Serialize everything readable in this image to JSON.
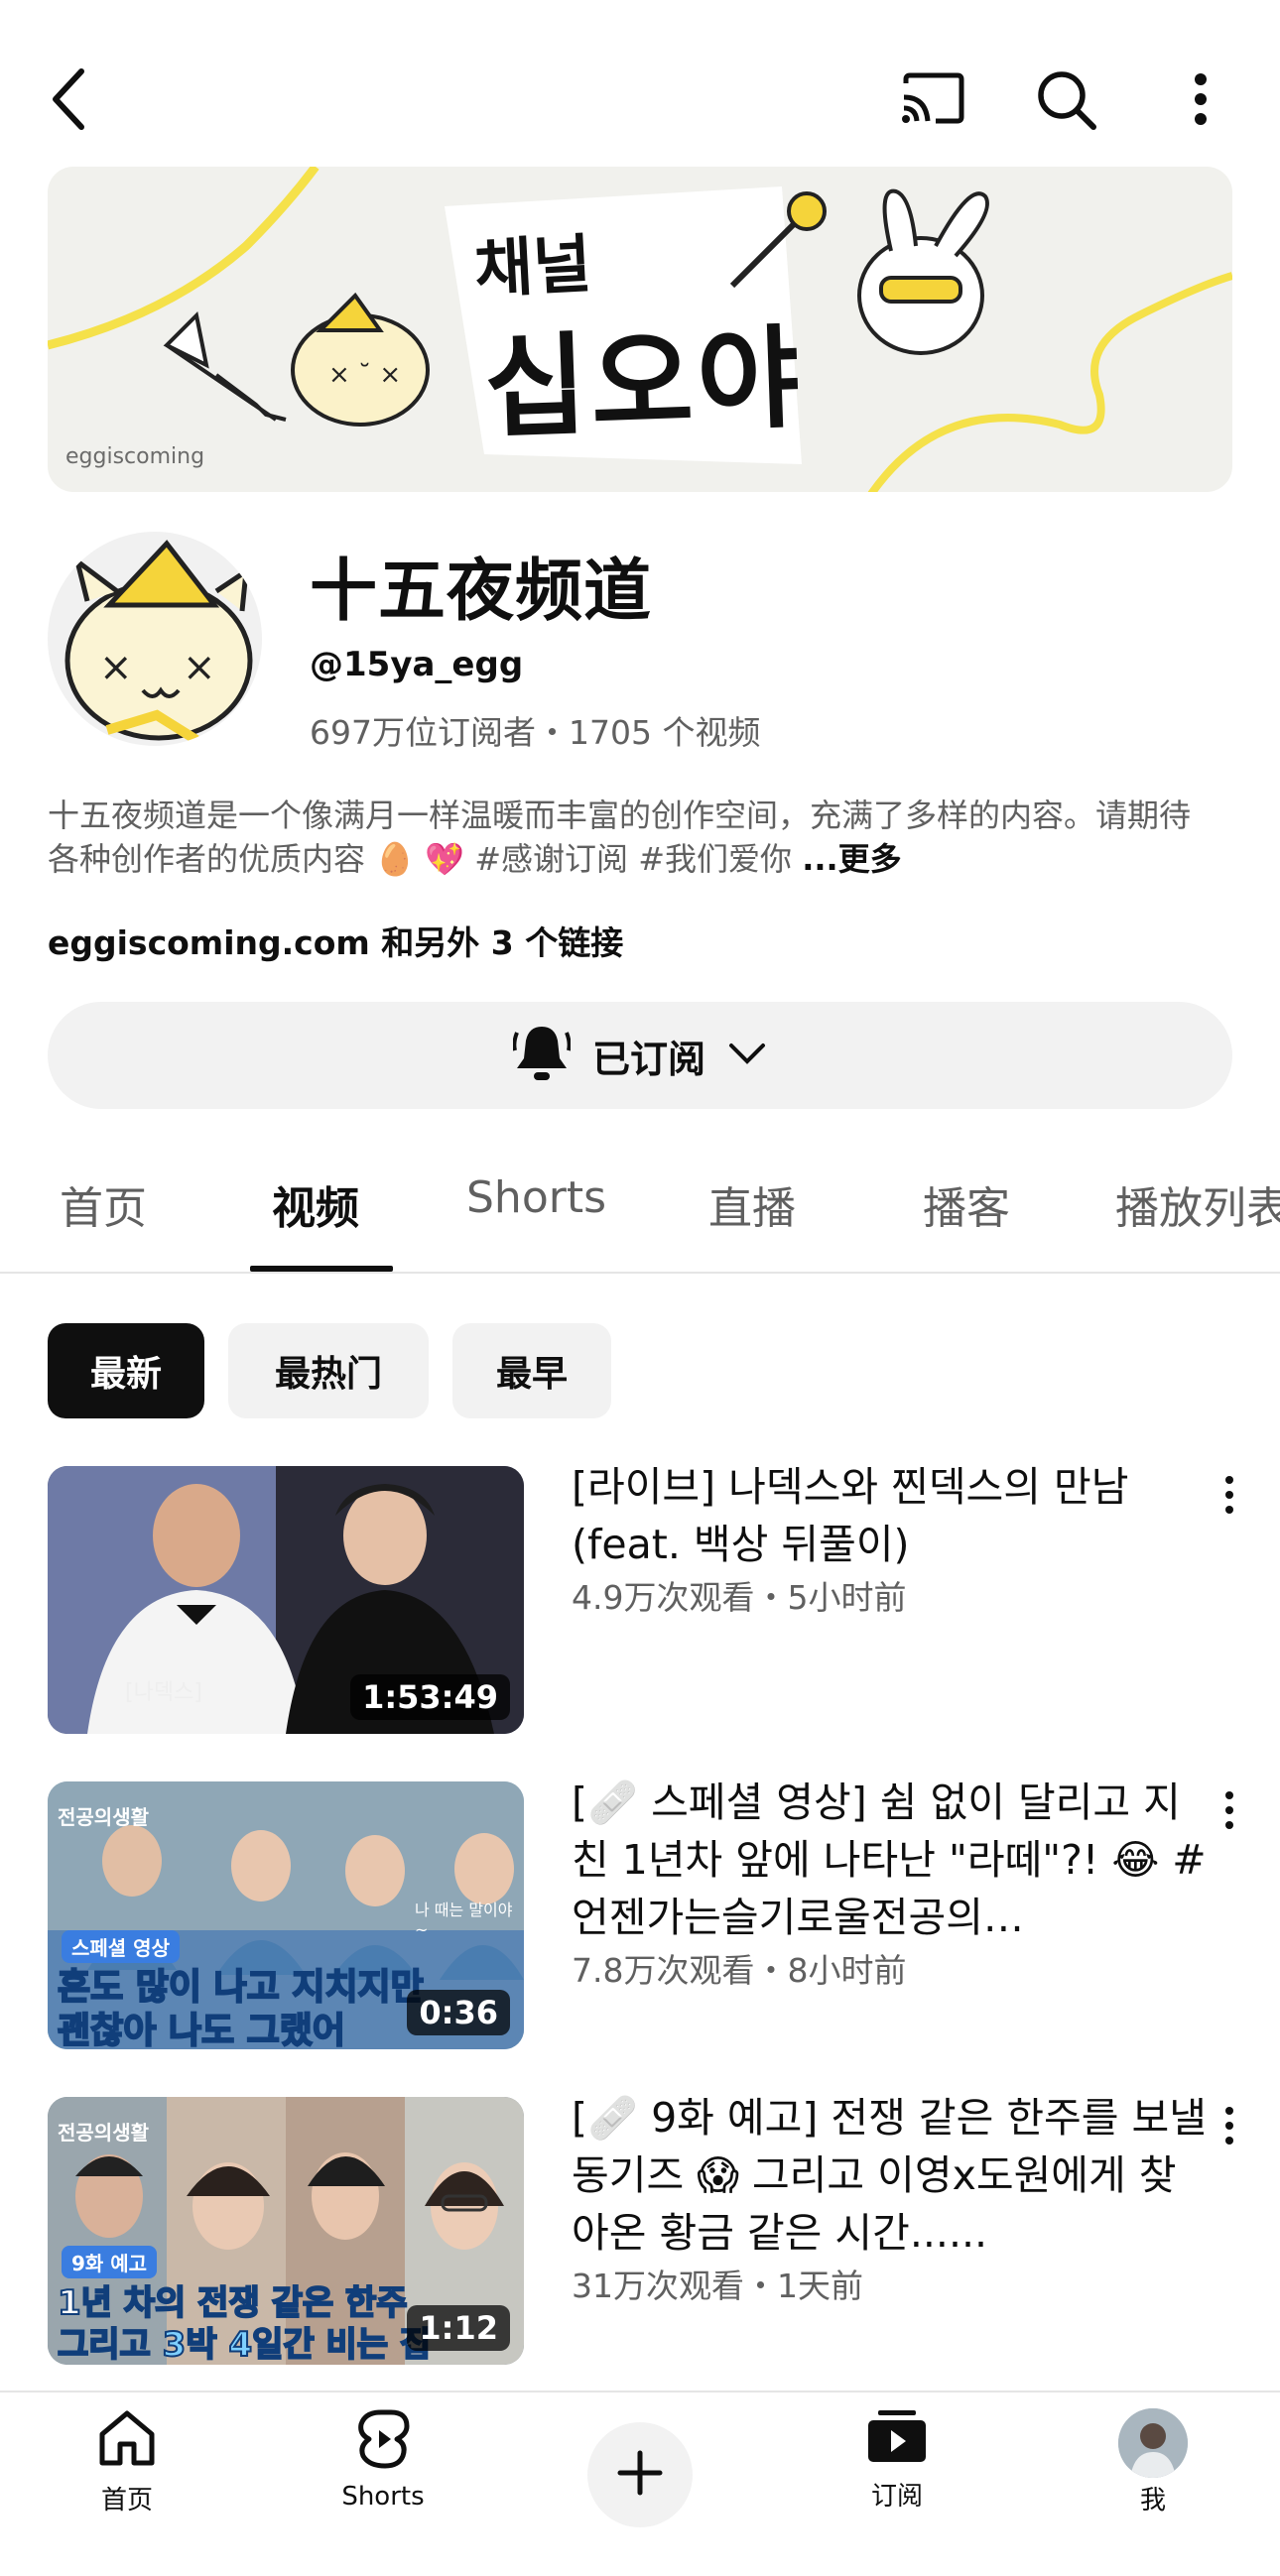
{
  "banner": {
    "korean_title_line1": "채널",
    "korean_title_line2": "십오야",
    "watermark": "eggiscoming"
  },
  "channel": {
    "name": "十五夜频道",
    "handle": "@15ya_egg",
    "stats": "697万位订阅者・1705 个视频",
    "description": "十五夜频道是一个像满月一样温暖而丰富的创作空间，充满了多样的内容。请期待各种创作者的优质内容 🥚 💖 #感谢订阅 #我们爱你",
    "more_label": "...更多",
    "links": "eggiscoming.com 和另外 3 个链接"
  },
  "subscribe": {
    "label": "已订阅"
  },
  "tabs": [
    {
      "label": "首页"
    },
    {
      "label": "视频"
    },
    {
      "label": "Shorts"
    },
    {
      "label": "直播"
    },
    {
      "label": "播客"
    },
    {
      "label": "播放列表"
    }
  ],
  "active_tab": "视频",
  "chips": [
    {
      "label": "最新"
    },
    {
      "label": "最热门"
    },
    {
      "label": "最早"
    }
  ],
  "videos": [
    {
      "title": "[라이브] 나덱스와 찐덱스의 만남 (feat. 백상 뒤풀이)",
      "meta": "4.9万次观看・5小时前",
      "duration": "1:53:49",
      "thumb_caption": "[나덱스]"
    },
    {
      "title": "[🩹 스페셜 영상] 쉼 없이 달리고 지친 1년차 앞에 나타난 \"라떼\"?! 😂 #언젠가는슬기로울전공의…",
      "meta": "7.8万次观看・8小时前",
      "duration": "0:36",
      "thumb_tag": "스페셜 영상",
      "thumb_line1": "혼도 많이 나고 지치지만",
      "thumb_line2": "괜찮아 나도 그랬어",
      "thumb_small": "나 때는 말이야~",
      "thumb_logo": "전공의생활"
    },
    {
      "title": "[🩹 9화 예고] 전쟁 같은 한주를 보낼 동기즈 😱 그리고 이영x도원에게 찾아온 황금 같은 시간......",
      "meta": "31万次观看・1天前",
      "duration": "1:12",
      "thumb_tag": "9화 예고",
      "thumb_line1": "1년 차의 전쟁 같은 한주",
      "thumb_line2": "그리고 3박 4일간 비는 집",
      "thumb_logo": "전공의생활"
    }
  ],
  "bottom_nav": [
    {
      "label": "首页",
      "icon": "home-icon"
    },
    {
      "label": "Shorts",
      "icon": "shorts-icon"
    },
    {
      "label": "",
      "icon": "plus-icon"
    },
    {
      "label": "订阅",
      "icon": "subscriptions-icon"
    },
    {
      "label": "我",
      "icon": "avatar"
    }
  ]
}
